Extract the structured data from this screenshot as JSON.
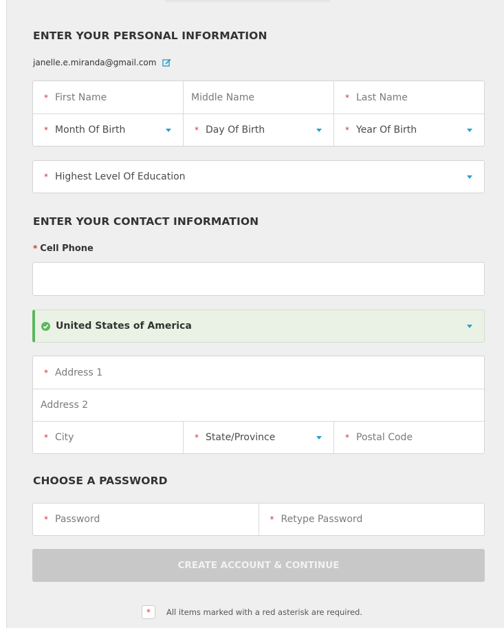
{
  "personal": {
    "heading": "ENTER YOUR PERSONAL INFORMATION",
    "email": "janelle.e.miranda@gmail.com",
    "first_name_placeholder": "First Name",
    "middle_name_placeholder": "Middle Name",
    "last_name_placeholder": "Last Name",
    "month_of_birth": "Month Of Birth",
    "day_of_birth": "Day Of Birth",
    "year_of_birth": "Year Of Birth",
    "education": "Highest Level Of Education"
  },
  "contact": {
    "heading": "ENTER YOUR CONTACT INFORMATION",
    "cell_phone_label": "Cell Phone",
    "cell_phone_value": "",
    "country": "United States of America",
    "address1_placeholder": "Address 1",
    "address2_placeholder": "Address 2",
    "city_placeholder": "City",
    "state": "State/Province",
    "postal_placeholder": "Postal Code"
  },
  "password": {
    "heading": "CHOOSE A PASSWORD",
    "password_placeholder": "Password",
    "retype_placeholder": "Retype Password"
  },
  "submit_label": "CREATE ACCOUNT & CONTINUE",
  "footnote": "All items marked with a red asterisk are required.",
  "required_mark": "*",
  "colors": {
    "required": "#d0363b",
    "accent": "#2aa0c9",
    "success": "#5cb85c",
    "disabled_button": "#c8c8c8"
  }
}
